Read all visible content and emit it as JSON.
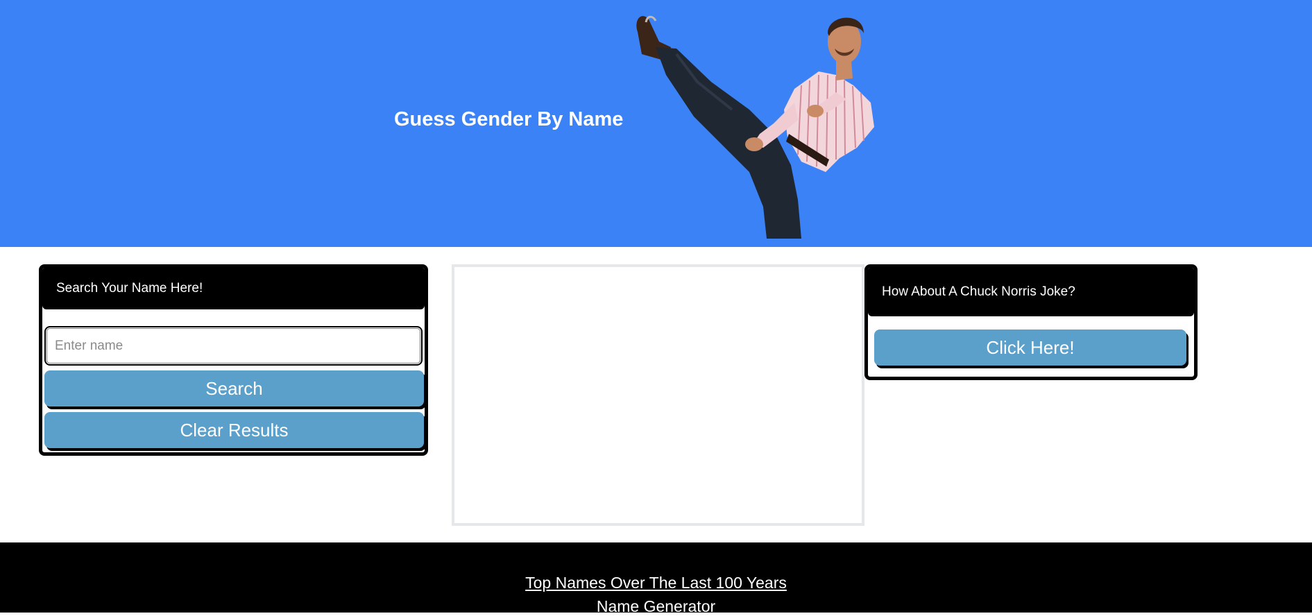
{
  "header": {
    "title": "Guess Gender By Name",
    "image": "karate-kick-man-illustration",
    "background_color": "#3b82f6"
  },
  "search_panel": {
    "heading": "Search Your Name Here!",
    "input_placeholder": "Enter name",
    "input_value": "",
    "search_label": "Search",
    "clear_label": "Clear Results"
  },
  "results": {
    "content": ""
  },
  "joke_panel": {
    "heading": "How About A Chuck Norris Joke?",
    "button_label": "Click Here!"
  },
  "footer": {
    "links": [
      "Top Names Over The Last 100 Years",
      "Name Generator"
    ]
  },
  "colors": {
    "button": "#5b9fcb",
    "panel_border": "#000000",
    "footer": "#000000"
  }
}
